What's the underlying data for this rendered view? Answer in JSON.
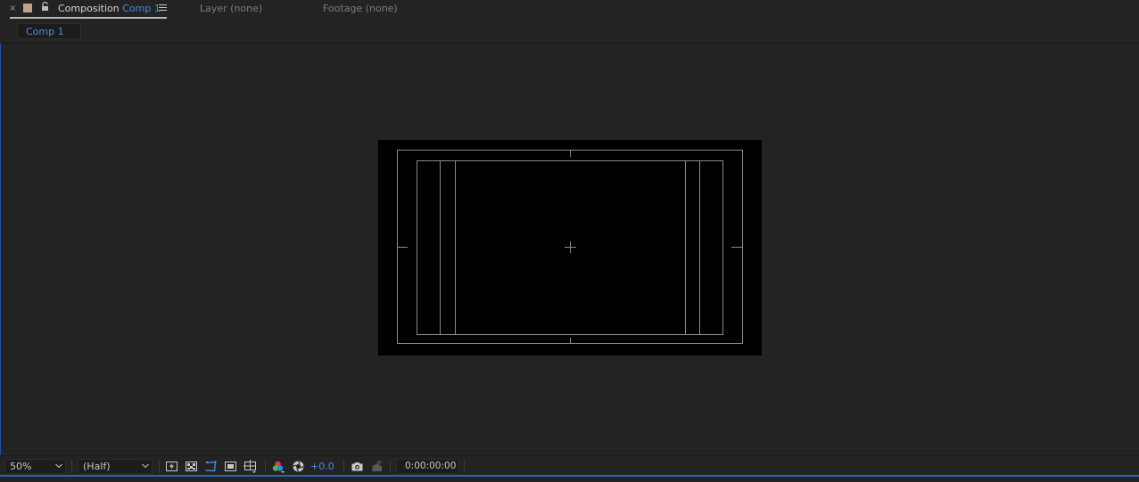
{
  "tabs": {
    "close_glyph": "×",
    "swatch_color": "#bfa588",
    "composition_prefix": "Composition",
    "composition_name": "Comp 1",
    "layer_label": "Layer (none)",
    "footage_label": "Footage (none)"
  },
  "breadcrumb": {
    "comp_label": "Comp 1"
  },
  "toolbar": {
    "magnification": "50%",
    "resolution": "(Half)",
    "exposure": "+0.0",
    "timecode": "0:00:00:00"
  },
  "icons": [
    "fast-previews-icon",
    "transparency-grid-icon",
    "mask-path-visibility-icon",
    "region-of-interest-icon",
    "grid-guides-icon",
    "show-channel-icon",
    "reset-exposure-icon",
    "snapshot-icon",
    "show-snapshot-icon"
  ],
  "colors": {
    "accent": "#3f8fe6",
    "panel_bg": "#232323",
    "canvas_bg": "#000000",
    "focus_border": "#2a62c9"
  }
}
